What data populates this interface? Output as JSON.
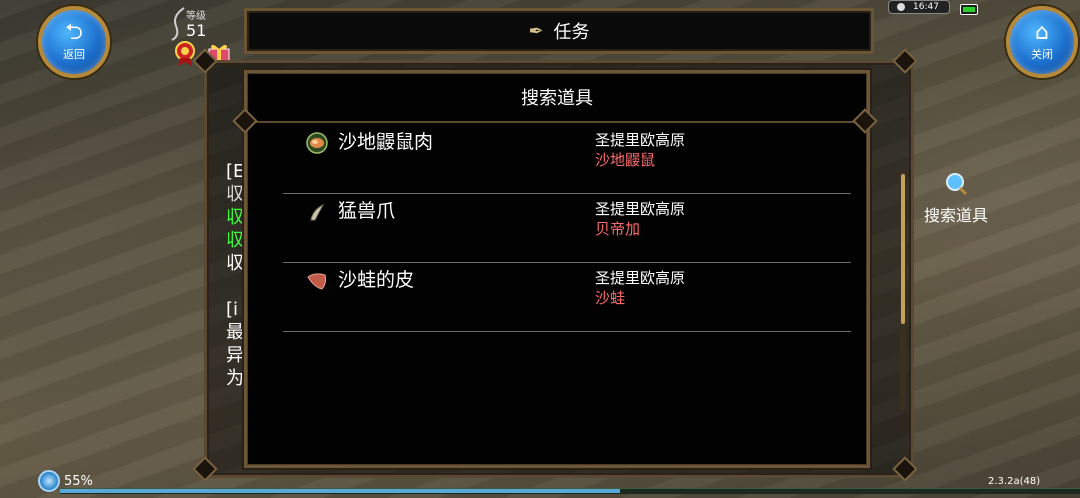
{
  "hud": {
    "back_label": "返回",
    "close_label": "关闭",
    "level_label": "等级",
    "level_value": "51",
    "clock": "16:47",
    "battery_percent": "55%",
    "version": "2.3.2a(48)"
  },
  "task_panel": {
    "title": "任务",
    "behind_text_lines": [
      "[E",
      "収",
      "収",
      "収",
      "収",
      "",
      "[i",
      "最",
      "异",
      "为"
    ]
  },
  "side_shortcut": {
    "label": "搜索道具",
    "icon": "magnifier-icon"
  },
  "dialog": {
    "title": "搜索道具",
    "items": [
      {
        "name": "沙地鼹鼠肉",
        "region": "圣提里欧高原",
        "source": "沙地鼹鼠",
        "icon": "meat-icon"
      },
      {
        "name": "猛兽爪",
        "region": "圣提里欧高原",
        "source": "贝帝加",
        "icon": "claw-icon"
      },
      {
        "name": "沙蛙的皮",
        "region": "圣提里欧高原",
        "source": "沙蛙",
        "icon": "hide-icon"
      }
    ]
  },
  "colors": {
    "source_text": "#ff6a6a",
    "frame": "#6b5637",
    "button_blue": "#1b6fcc"
  }
}
